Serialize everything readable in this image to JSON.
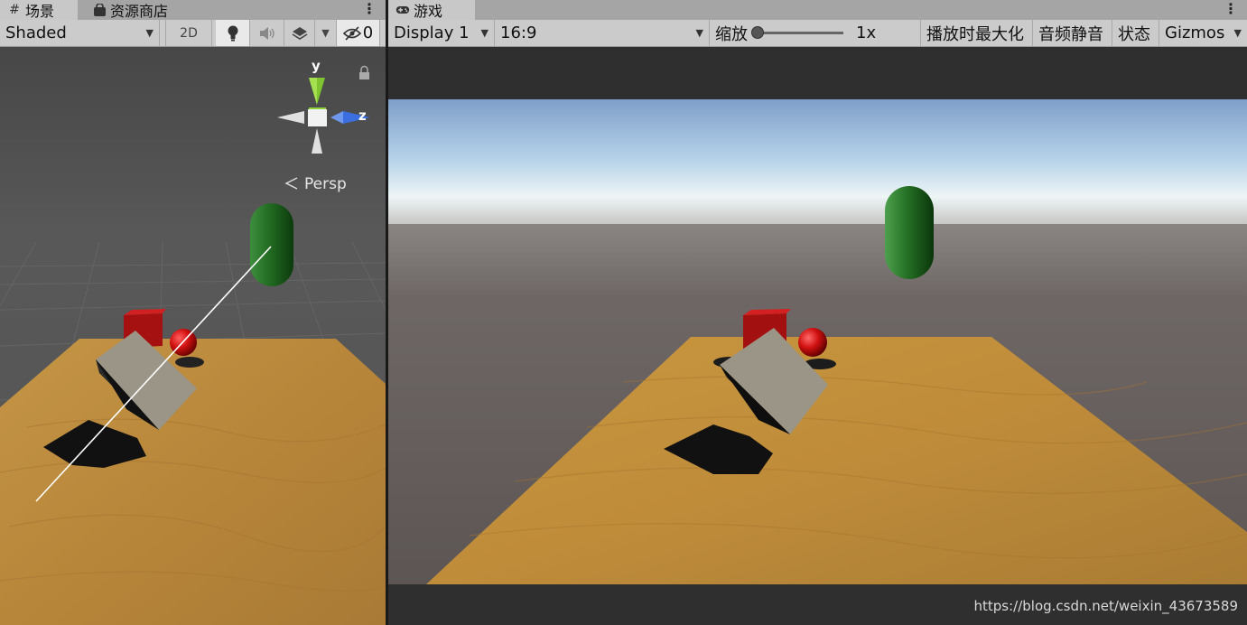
{
  "scene": {
    "tabs": [
      {
        "label": "场景",
        "icon": "grid-icon",
        "active": true
      },
      {
        "label": "资源商店",
        "icon": "store-bag-icon",
        "active": false
      }
    ],
    "toolbar": {
      "shading_mode": "Shaded",
      "btn_2d": "2D",
      "hidden_count": "0"
    },
    "gizmo": {
      "y_label": "y",
      "z_label": "z",
      "projection": "Persp"
    }
  },
  "game": {
    "tab": {
      "label": "游戏",
      "icon": "gamepad-icon"
    },
    "toolbar": {
      "display": "Display 1",
      "aspect": "16:9",
      "scale_label": "缩放",
      "scale_value": "1x",
      "scale_fraction": 0,
      "maximize_on_play": "播放时最大化",
      "mute_audio": "音频静音",
      "stats": "状态",
      "gizmos": "Gizmos"
    }
  },
  "watermark": "https://blog.csdn.net/weixin_43673589",
  "colors": {
    "tab_bar": "#a5a5a5",
    "toolbar": "#cbcbcb",
    "scene_bg": "#474747",
    "table_wood": "#c8963c",
    "capsule_green": "#2c7a2c",
    "cube_red": "#b41414",
    "sphere_red": "#d01010",
    "cube_grey": "#9a9586",
    "sky_top": "#7fa2cd",
    "ground": "#6f6866",
    "gizmo_y": "#8cd43a",
    "gizmo_z": "#3b6fe0"
  }
}
